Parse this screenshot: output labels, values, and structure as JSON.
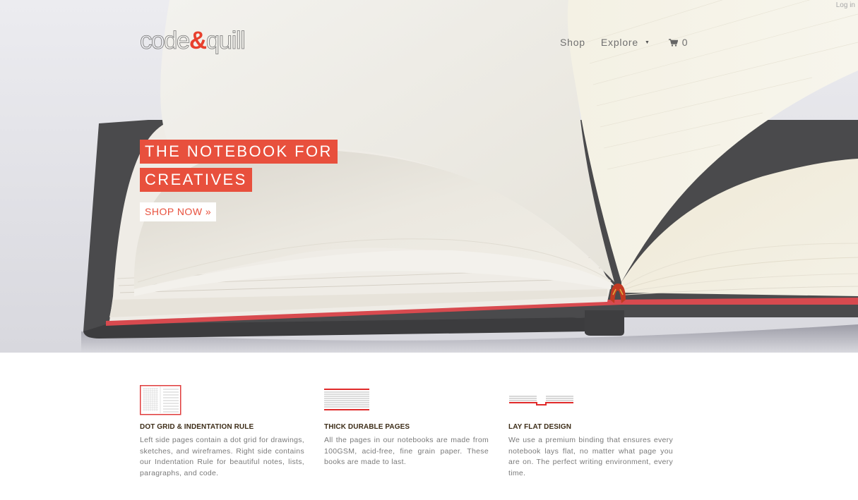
{
  "header": {
    "login_label": "Log in",
    "logo": {
      "part1": "code",
      "amp": "&",
      "part2": "quill"
    },
    "nav": {
      "shop_label": "Shop",
      "explore_label": "Explore",
      "explore_caret_icon": "caret-down-icon",
      "cart_icon": "shopping-cart-icon",
      "cart_count": "0"
    }
  },
  "hero": {
    "headline_line1": "THE NOTEBOOK FOR",
    "headline_line2": "CREATIVES",
    "cta_label": "SHOP NOW »",
    "image": "open-notebook-photo"
  },
  "features": [
    {
      "icon": "dot-grid-notebook-icon",
      "title": "DOT GRID & INDENTATION RULE",
      "text": "Left side pages contain a dot grid for drawings, sketches, and wireframes. Right side contains our Indentation Rule for beautiful notes, lists, paragraphs, and code."
    },
    {
      "icon": "thick-pages-icon",
      "title": "THICK DURABLE PAGES",
      "text": "All the pages in our notebooks are made from 100GSM, acid-free, fine grain paper. These books are made to last."
    },
    {
      "icon": "lay-flat-icon",
      "title": "LAY FLAT DESIGN",
      "text": "We use a premium binding that ensures every notebook lays flat, no matter what page you are on. The perfect writing environment, every time."
    }
  ],
  "colors": {
    "accent": "#e8503d",
    "heading": "#3d2d18",
    "body_text": "#7a7a7a",
    "nav_text": "#707070"
  }
}
